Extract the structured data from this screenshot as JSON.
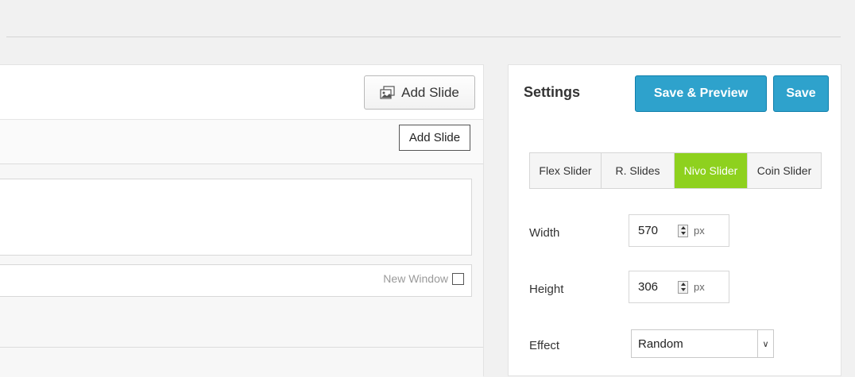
{
  "slides": {
    "add_slide_label": "Add Slide",
    "tooltip_text": "Add Slide",
    "new_window_label": "New Window"
  },
  "settings": {
    "title": "Settings",
    "save_preview_label": "Save & Preview",
    "save_label": "Save",
    "tabs": [
      {
        "label": "Flex Slider",
        "active": false
      },
      {
        "label": "R. Slides",
        "active": false
      },
      {
        "label": "Nivo Slider",
        "active": true
      },
      {
        "label": "Coin Slider",
        "active": false
      }
    ],
    "width": {
      "label": "Width",
      "value": "570",
      "unit": "px"
    },
    "height": {
      "label": "Height",
      "value": "306",
      "unit": "px"
    },
    "effect": {
      "label": "Effect",
      "value": "Random"
    },
    "colors": {
      "accent_blue": "#2ea2cc",
      "active_tab_green": "#8ed11e"
    }
  }
}
